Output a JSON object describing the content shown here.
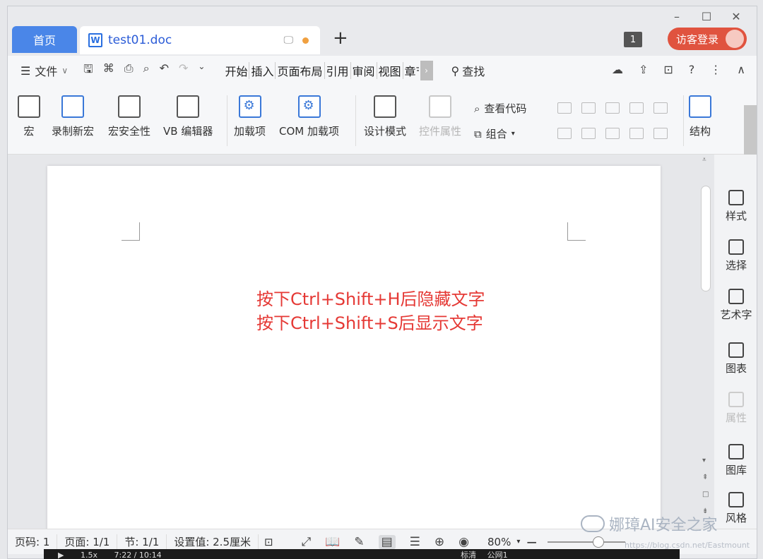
{
  "window": {
    "controls": [
      "–",
      "☐",
      "✕"
    ]
  },
  "tabs": {
    "home": "首页",
    "doc_title": "test01.doc",
    "add": "+",
    "count": "1",
    "login": "访客登录"
  },
  "menu": {
    "file": "文件",
    "tabs": [
      "开始",
      "插入",
      "页面布局",
      "引用",
      "审阅",
      "视图",
      "章节"
    ],
    "search": "查找"
  },
  "ribbon": {
    "macro": "宏",
    "record_macro": "录制新宏",
    "macro_security": "宏安全性",
    "vb_editor": "VB 编辑器",
    "addins": "加载项",
    "com_addins": "COM 加载项",
    "design_mode": "设计模式",
    "control_props": "控件属性",
    "view_code": "查看代码",
    "group": "组合",
    "structure": "结构"
  },
  "document": {
    "line1": "按下Ctrl+Shift+H后隐藏文字",
    "line2": "按下Ctrl+Shift+S后显示文字",
    "text_color": "#e53935"
  },
  "right_panel": {
    "style": "样式",
    "select": "选择",
    "wordart": "艺术字",
    "chart": "图表",
    "props": "属性",
    "gallery": "图库",
    "theme": "风格"
  },
  "status": {
    "page_num": "页码: 1",
    "page": "页面: 1/1",
    "section": "节: 1/1",
    "setting": "设置值: 2.5厘米",
    "zoom": "80%"
  },
  "watermark": {
    "text": "娜璋AI安全之家",
    "url": "https://blog.csdn.net/Eastmount"
  },
  "player": {
    "speed": "1.5x",
    "time": "7:22 / 10:14",
    "quality": "标清",
    "source": "公网1"
  }
}
